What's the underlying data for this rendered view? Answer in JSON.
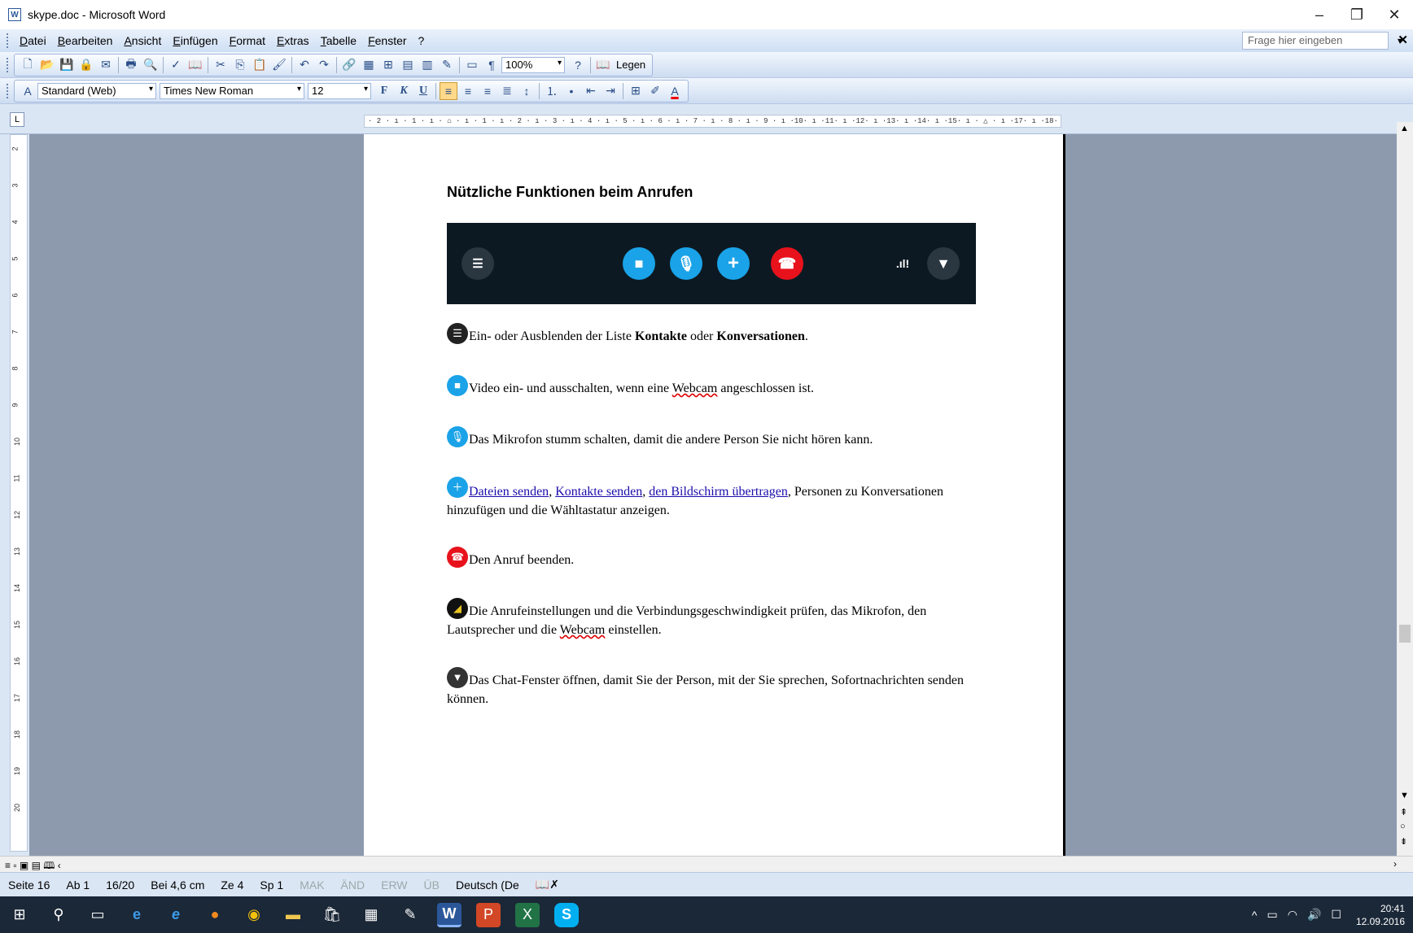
{
  "window": {
    "title": "skype.doc - Microsoft Word",
    "icon": "word-doc-icon"
  },
  "menu": {
    "items": [
      "Datei",
      "Bearbeiten",
      "Ansicht",
      "Einfügen",
      "Format",
      "Extras",
      "Tabelle",
      "Fenster",
      "?"
    ],
    "help_placeholder": "Frage hier eingeben"
  },
  "toolbar": {
    "zoom": "100%",
    "read_label": "Legen"
  },
  "format_bar": {
    "style": "Standard (Web)",
    "font": "Times New Roman",
    "size": "12",
    "bold": "F",
    "italic": "K",
    "underline": "U"
  },
  "ruler": {
    "h_ticks": "· 2 · ı · 1 · ı · ⌂ · ı · 1 · ı · 2 · ı · 3 · ı · 4 · ı · 5 · ı · 6 · ı · 7 · ı · 8 · ı · 9 · ı ·10· ı ·11· ı ·12· ı ·13· ı ·14· ı ·15· ı · △ · ı ·17· ı ·18·",
    "v_ticks": [
      "2",
      "3",
      "4",
      "5",
      "6",
      "7",
      "8",
      "9",
      "10",
      "11",
      "12",
      "13",
      "14",
      "15",
      "16",
      "17",
      "18",
      "19",
      "20"
    ]
  },
  "document": {
    "heading": "Nützliche Funktionen beim Anrufen",
    "paragraphs": [
      {
        "icon": "list-icon",
        "text_a": "Ein- oder Ausblenden der Liste ",
        "bold1": "Kontakte",
        "text_b": " oder ",
        "bold2": "Konversationen",
        "text_c": "."
      },
      {
        "icon": "video-icon",
        "text_a": "Video ein- und ausschalten, wenn eine ",
        "spell": "Webcam",
        "text_b": " angeschlossen ist."
      },
      {
        "icon": "mic-icon",
        "text": "Das Mikrofon stumm schalten, damit die andere Person Sie nicht hören kann."
      },
      {
        "icon": "plus-icon",
        "link1": "Dateien senden",
        "link2": "Kontakte senden",
        "link3": "den Bildschirm übertragen",
        "text": ", Personen zu Konversationen hinzufügen und die Wähltastatur anzeigen."
      },
      {
        "icon": "hangup-icon",
        "text": "Den Anruf beenden."
      },
      {
        "icon": "signal-icon",
        "text_a": "Die Anrufeinstellungen und die Verbindungsgeschwindigkeit prüfen, das Mikrofon, den Lautsprecher und die ",
        "spell": "Webcam",
        "text_b": " einstellen."
      },
      {
        "icon": "chat-icon",
        "text": "Das Chat-Fenster öffnen, damit Sie der Person, mit der Sie sprechen, Sofortnachrichten senden können."
      }
    ]
  },
  "status": {
    "page": "Seite 16",
    "section": "Ab 1",
    "pages": "16/20",
    "pos": "Bei 4,6 cm",
    "line": "Ze 4",
    "col": "Sp 1",
    "mak": "MAK",
    "and": "ÄND",
    "erw": "ERW",
    "ub": "ÜB",
    "lang": "Deutsch (De"
  },
  "tray": {
    "time": "20:41",
    "date": "12.09.2016"
  },
  "colors": {
    "skype_blue": "#1aa3e8",
    "hangup_red": "#e8121c",
    "callbar_bg": "#0d1922",
    "link": "#1a0dab"
  }
}
